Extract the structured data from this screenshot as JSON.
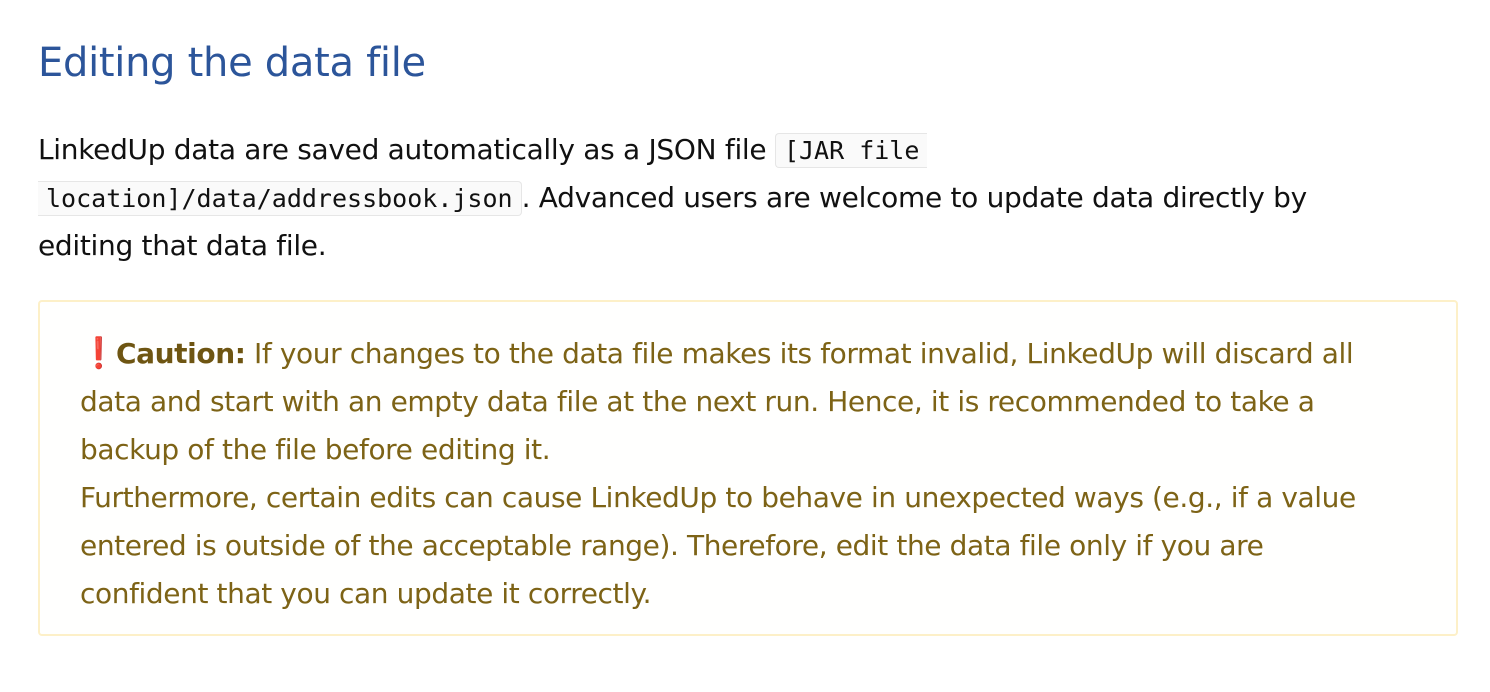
{
  "section": {
    "heading": "Editing the data file"
  },
  "intro": {
    "text_1": "LinkedUp data are saved automatically as a JSON file ",
    "code_part_1": "[JAR file",
    "code_part_2": "location]/data/addressbook.json",
    "text_2": ". Advanced users are welcome to update data directly by",
    "text_3": "editing that data file."
  },
  "caution": {
    "icon": "exclamation-icon",
    "icon_glyph": "❗",
    "label": "Caution:",
    "line_1": " If your changes to the data file makes its format invalid, LinkedUp will discard all",
    "line_2": "data and start with an empty data file at the next run. Hence, it is recommended to take a",
    "line_3": "backup of the file before editing it.",
    "line_4": "Furthermore, certain edits can cause LinkedUp to behave in unexpected ways (e.g., if a value",
    "line_5": "entered is outside of the acceptable range). Therefore, edit the data file only if you are",
    "line_6": "confident that you can update it correctly."
  },
  "colors": {
    "heading": "#2c559a",
    "callout_text": "#7d6316",
    "callout_border": "#fdf0c8",
    "icon": "#d9202f"
  }
}
